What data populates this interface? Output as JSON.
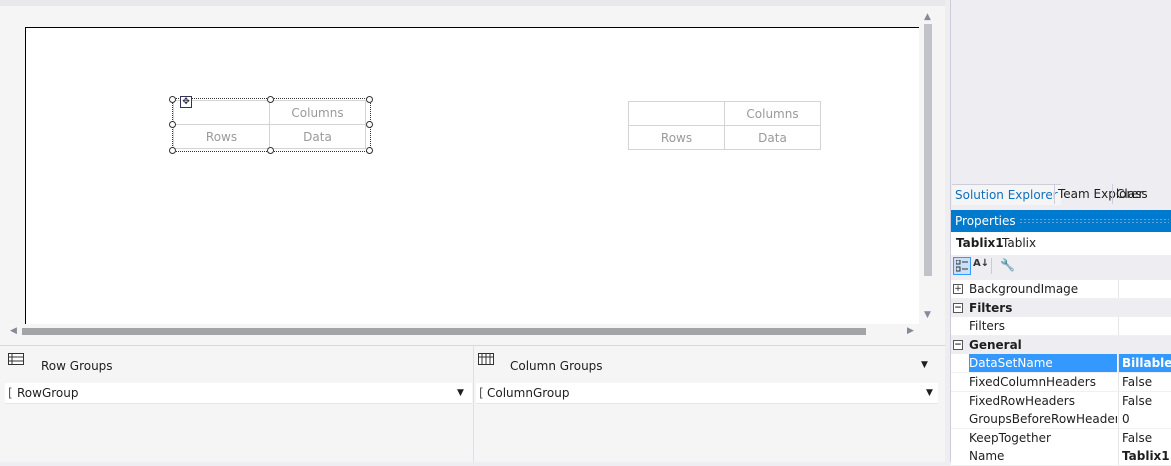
{
  "designer": {
    "tablix_left": {
      "header": "Columns",
      "row_label": "Rows",
      "data_label": "Data"
    },
    "tablix_right": {
      "header": "Columns",
      "row_label": "Rows",
      "data_label": "Data"
    }
  },
  "grouping": {
    "row_groups_title": "Row Groups",
    "column_groups_title": "Column Groups",
    "row_group_item": "RowGroup",
    "column_group_item": "ColumnGroup"
  },
  "tabs": [
    {
      "label": "Solution Explorer",
      "active": true
    },
    {
      "label": "Team Explorer",
      "active": false
    },
    {
      "label": "Class",
      "active": false
    }
  ],
  "properties": {
    "title": "Properties",
    "object_name": "Tablix1",
    "object_type": "Tablix",
    "rows": [
      {
        "kind": "prop",
        "expander": "+",
        "name": "BackgroundImage",
        "value": ""
      },
      {
        "kind": "cat",
        "expander": "−",
        "name": "Filters",
        "value": ""
      },
      {
        "kind": "prop",
        "expander": "",
        "name": "Filters",
        "value": ""
      },
      {
        "kind": "cat",
        "expander": "−",
        "name": "General",
        "value": ""
      },
      {
        "kind": "prop",
        "expander": "",
        "name": "DataSetName",
        "value": "Billable",
        "selected": true
      },
      {
        "kind": "prop",
        "expander": "",
        "name": "FixedColumnHeaders",
        "value": "False"
      },
      {
        "kind": "prop",
        "expander": "",
        "name": "FixedRowHeaders",
        "value": "False"
      },
      {
        "kind": "prop",
        "expander": "",
        "name": "GroupsBeforeRowHeaders",
        "value": "0"
      },
      {
        "kind": "prop",
        "expander": "",
        "name": "KeepTogether",
        "value": "False"
      },
      {
        "kind": "prop",
        "expander": "",
        "name": "Name",
        "value": "Tablix1"
      }
    ]
  },
  "colors": {
    "accent": "#007acc",
    "selected_row": "#3399ff"
  }
}
